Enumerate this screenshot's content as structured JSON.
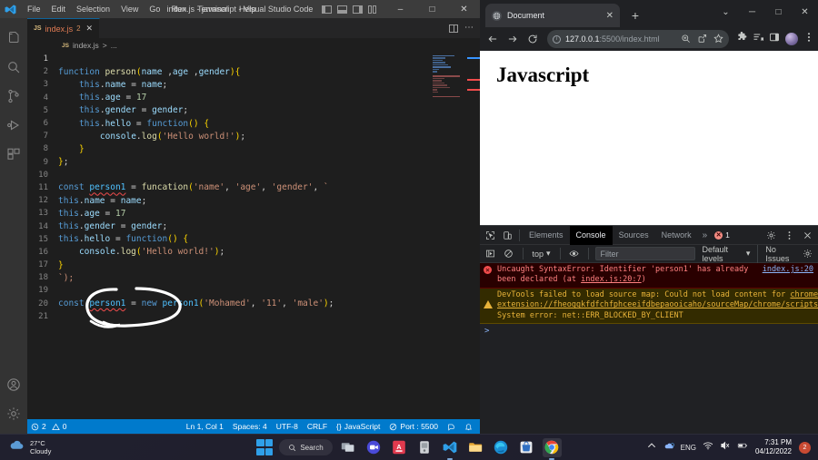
{
  "vscode": {
    "window_title": "index.js - javascript - Visual Studio Code",
    "menu": [
      "File",
      "Edit",
      "Selection",
      "View",
      "Go",
      "Run",
      "Terminal",
      "Help"
    ],
    "tab": {
      "file_icon_label": "JS",
      "filename": "index.js",
      "dirty_count": "2",
      "close_label": "✕"
    },
    "breadcrumb": {
      "file_icon_label": "JS",
      "filename": "index.js",
      "separator": ">",
      "tail": "..."
    },
    "activitybar": [
      {
        "name": "explorer",
        "icon": "files-icon"
      },
      {
        "name": "search",
        "icon": "search-icon"
      },
      {
        "name": "source-control",
        "icon": "source-control-icon"
      },
      {
        "name": "run-and-debug",
        "icon": "run-debug-icon"
      },
      {
        "name": "extensions",
        "icon": "extensions-icon"
      },
      {
        "name": "accounts",
        "icon": "account-icon"
      },
      {
        "name": "settings",
        "icon": "gear-icon"
      }
    ],
    "code_lines": [
      {
        "n": "1",
        "text": ""
      },
      {
        "n": "2",
        "text": "function person(name ,age ,gender){"
      },
      {
        "n": "3",
        "text": "    this.name = name;"
      },
      {
        "n": "4",
        "text": "    this.age = 17"
      },
      {
        "n": "5",
        "text": "    this.gender = gender;"
      },
      {
        "n": "6",
        "text": "    this.hello = function() {"
      },
      {
        "n": "7",
        "text": "        console.log('Hello world!');"
      },
      {
        "n": "8",
        "text": "    }"
      },
      {
        "n": "9",
        "text": "};"
      },
      {
        "n": "10",
        "text": ""
      },
      {
        "n": "11",
        "text": "const person1 = funcation('name', 'age', 'gender', `"
      },
      {
        "n": "12",
        "text": "this.name = name;"
      },
      {
        "n": "13",
        "text": "this.age = 17"
      },
      {
        "n": "14",
        "text": "this.gender = gender;"
      },
      {
        "n": "15",
        "text": "this.hello = function() {"
      },
      {
        "n": "16",
        "text": "    console.log('Hello world!');"
      },
      {
        "n": "17",
        "text": "}"
      },
      {
        "n": "18",
        "text": "`);"
      },
      {
        "n": "19",
        "text": ""
      },
      {
        "n": "20",
        "text": "const person1 = new person1('Mohamed', '11', 'male');"
      },
      {
        "n": "21",
        "text": ""
      }
    ],
    "statusbar": {
      "errors": "2",
      "warnings": "0",
      "cursor": "Ln 1, Col 1",
      "spaces": "Spaces: 4",
      "encoding": "UTF-8",
      "eol": "CRLF",
      "language": "JavaScript",
      "port": "Port : 5500",
      "feedback_icon": "smiley-icon",
      "notifications_icon": "bell-icon"
    }
  },
  "chrome": {
    "tab": {
      "title": "Document",
      "favicon": "globe-icon",
      "close_label": "✕"
    },
    "newtab_label": "+",
    "window_controls": {
      "chevron": "⌄",
      "minimize": "─",
      "maximize": "□",
      "close": "✕"
    },
    "nav": {
      "back": "back-icon",
      "forward": "forward-icon",
      "reload": "reload-icon"
    },
    "omnibox": {
      "site_info_label": "i",
      "url_host": "127.0.0.1",
      "url_rest": ":5500/index.html",
      "icons": [
        "zoom-icon",
        "share-icon",
        "bookmark-star-icon"
      ]
    },
    "extension_icons": [
      "puzzle-extensions-icon",
      "reading-list-icon",
      "side-panel-icon",
      "profile-avatar",
      "three-dot-menu-icon"
    ],
    "page": {
      "heading": "Javascript"
    }
  },
  "devtools": {
    "toolbar_icons": [
      "inspect-element-icon",
      "device-toolbar-icon"
    ],
    "tabs": [
      {
        "label": "Elements",
        "active": false
      },
      {
        "label": "Console",
        "active": true
      },
      {
        "label": "Sources",
        "active": false
      },
      {
        "label": "Network",
        "active": false
      }
    ],
    "more_tabs_label": "»",
    "error_count": "1",
    "settings_icon": "gear-icon",
    "kebab_icon": "three-dot-menu-icon",
    "close_icon": "close-icon",
    "filterbar": {
      "sidebar_toggle_icon": "console-sidebar-icon",
      "clear_icon": "clear-console-icon",
      "context": "top",
      "context_caret": "▾",
      "eye_icon": "live-expression-icon",
      "filter_placeholder": "Filter",
      "levels": "Default levels",
      "levels_caret": "▾",
      "issues": "No Issues",
      "settings_icon": "gear-icon"
    },
    "messages": [
      {
        "type": "error",
        "icon": "error-icon",
        "text_before": "Uncaught SyntaxError: Identifier 'person1' has already been declared (at ",
        "link": "index.js:20:7",
        "text_after": ")",
        "source": "index.js:20"
      },
      {
        "type": "warn",
        "icon": "warning-icon",
        "text_before": "DevTools failed to load source map: Could not load content for ",
        "link": "chrome-extension://fheoggkfdfchfphceeifdbepaooicaho/sourceMap/chrome/scripts/iframe_form_check.map",
        "text_after": ": System error: net::ERR_BLOCKED_BY_CLIENT",
        "source": ""
      }
    ],
    "prompt_symbol": ">"
  },
  "taskbar": {
    "weather": {
      "icon": "cloud-icon",
      "temperature": "27°C",
      "condition": "Cloudy"
    },
    "start_label": "start-button",
    "search_label": "Search",
    "apps": [
      {
        "name": "task-view",
        "icon": "task-view-icon"
      },
      {
        "name": "zoom",
        "icon": "zoom-app-icon"
      },
      {
        "name": "autodesk",
        "icon": "autodesk-icon"
      },
      {
        "name": "unknown-app",
        "icon": "app-icon"
      },
      {
        "name": "visual-studio-code",
        "icon": "vscode-icon"
      },
      {
        "name": "file-explorer",
        "icon": "folder-icon"
      },
      {
        "name": "microsoft-edge",
        "icon": "edge-icon"
      },
      {
        "name": "microsoft-store",
        "icon": "store-icon"
      },
      {
        "name": "google-chrome",
        "icon": "chrome-icon"
      }
    ],
    "system": {
      "chevron": "开",
      "onedrive_icon": "onedrive-icon",
      "language": "ENG",
      "wifi_icon": "wifi-icon",
      "volume_icon": "volume-muted-icon",
      "battery_icon": "battery-icon"
    },
    "clock": {
      "time": "7:31 PM",
      "date": "04/12/2022"
    },
    "notification_count": "2"
  }
}
